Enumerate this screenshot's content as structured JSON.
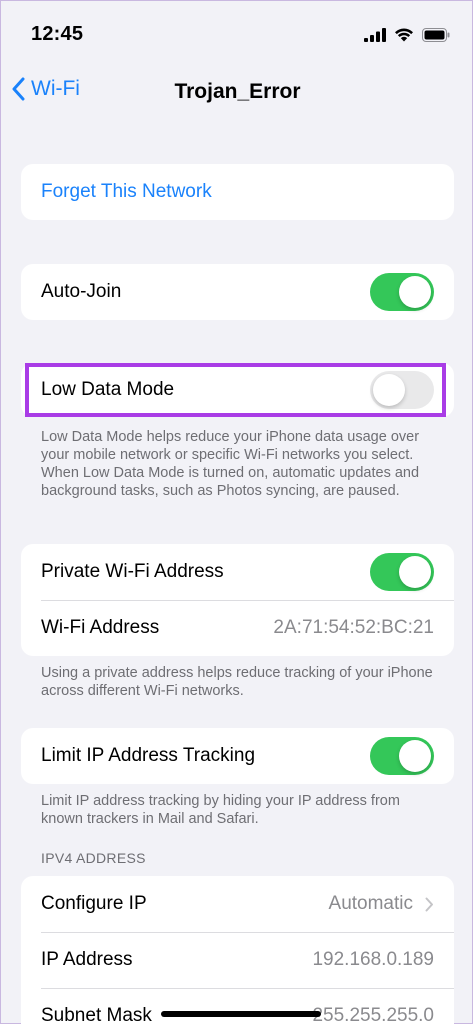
{
  "status_bar": {
    "time": "12:45"
  },
  "nav": {
    "back_label": "Wi-Fi",
    "title": "Trojan_Error"
  },
  "forget": {
    "label": "Forget This Network"
  },
  "auto_join": {
    "label": "Auto-Join",
    "enabled": true
  },
  "low_data": {
    "label": "Low Data Mode",
    "enabled": false,
    "footnote": "Low Data Mode helps reduce your iPhone data usage over your mobile network or specific Wi-Fi networks you select. When Low Data Mode is turned on, automatic updates and background tasks, such as Photos syncing, are paused."
  },
  "private_address": {
    "toggle_label": "Private Wi-Fi Address",
    "enabled": true,
    "address_label": "Wi-Fi Address",
    "address_value": "2A:71:54:52:BC:21",
    "footnote": "Using a private address helps reduce tracking of your iPhone across different Wi-Fi networks."
  },
  "limit_ip": {
    "label": "Limit IP Address Tracking",
    "enabled": true,
    "footnote": "Limit IP address tracking by hiding your IP address from known trackers in Mail and Safari."
  },
  "ipv4": {
    "header": "IPV4 ADDRESS",
    "configure_label": "Configure IP",
    "configure_value": "Automatic",
    "ip_label": "IP Address",
    "ip_value": "192.168.0.189",
    "subnet_label": "Subnet Mask",
    "subnet_value": "255.255.255.0"
  },
  "colors": {
    "accent": "#1a82fb",
    "toggle_on": "#34c759",
    "highlight": "#a93ce6"
  }
}
